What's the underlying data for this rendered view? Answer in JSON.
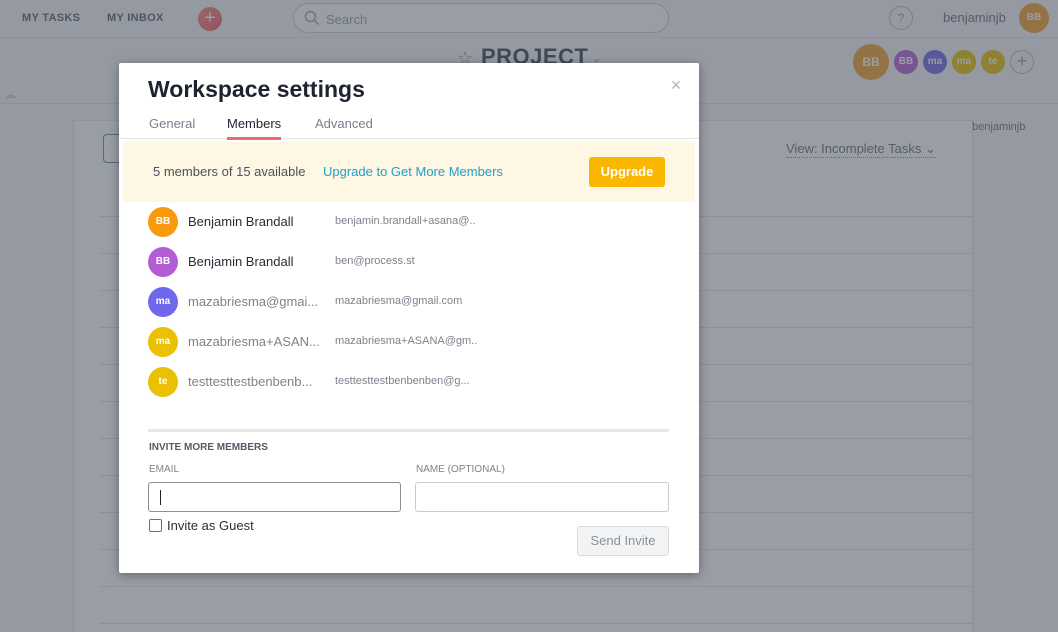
{
  "topbar": {
    "my_tasks": "MY TASKS",
    "my_inbox": "MY INBOX",
    "quick_add_icon": "+",
    "search_placeholder": "Search",
    "help_icon": "?",
    "username": "benjaminjb",
    "user_initials": "BB",
    "user_color": "#f1a12f"
  },
  "project": {
    "title": "PROJECT",
    "star_icon": "☆",
    "chevron_icon": "⌄",
    "collapse_icon": "︽",
    "owner": {
      "initials": "BB",
      "color": "#f1a12f"
    },
    "members": [
      {
        "initials": "BB",
        "color": "#b260d6"
      },
      {
        "initials": "ma",
        "color": "#7167e6"
      },
      {
        "initials": "ma",
        "color": "#e6c000"
      },
      {
        "initials": "te",
        "color": "#e6c000"
      }
    ],
    "add_member_icon": "+",
    "shared_with": "Shared with benjaminjb",
    "view_filter": "View: Incomplete Tasks ⌄"
  },
  "modal": {
    "title": "Workspace settings",
    "close_icon": "×",
    "tabs": [
      {
        "label": "General",
        "active": false
      },
      {
        "label": "Members",
        "active": true
      },
      {
        "label": "Advanced",
        "active": false
      }
    ],
    "banner": {
      "count_text": "5 members of 15 available",
      "upgrade_link": "Upgrade to Get More Members",
      "upgrade_button": "Upgrade"
    },
    "members": [
      {
        "initials": "BB",
        "color": "#f89a0d",
        "name": "Benjamin Brandall",
        "email": "benjamin.brandall+asana@..",
        "muted": false
      },
      {
        "initials": "BB",
        "color": "#b25cd6",
        "name": "Benjamin Brandall",
        "email": "ben@process.st",
        "muted": false
      },
      {
        "initials": "ma",
        "color": "#7068ea",
        "name": "mazabriesma@gmai...",
        "email": "mazabriesma@gmail.com",
        "muted": true
      },
      {
        "initials": "ma",
        "color": "#eac100",
        "name": "mazabriesma+ASAN...",
        "email": "mazabriesma+ASANA@gm..",
        "muted": true
      },
      {
        "initials": "te",
        "color": "#eac100",
        "name": "testtesttestbenbenb...",
        "email": "testtesttestbenbenben@g...",
        "muted": true
      }
    ],
    "invite": {
      "heading": "INVITE MORE MEMBERS",
      "email_label": "EMAIL",
      "email_value": "",
      "name_label": "NAME (OPTIONAL)",
      "name_value": "",
      "guest_label": "Invite as Guest",
      "guest_checked": false,
      "send_button": "Send Invite"
    }
  }
}
